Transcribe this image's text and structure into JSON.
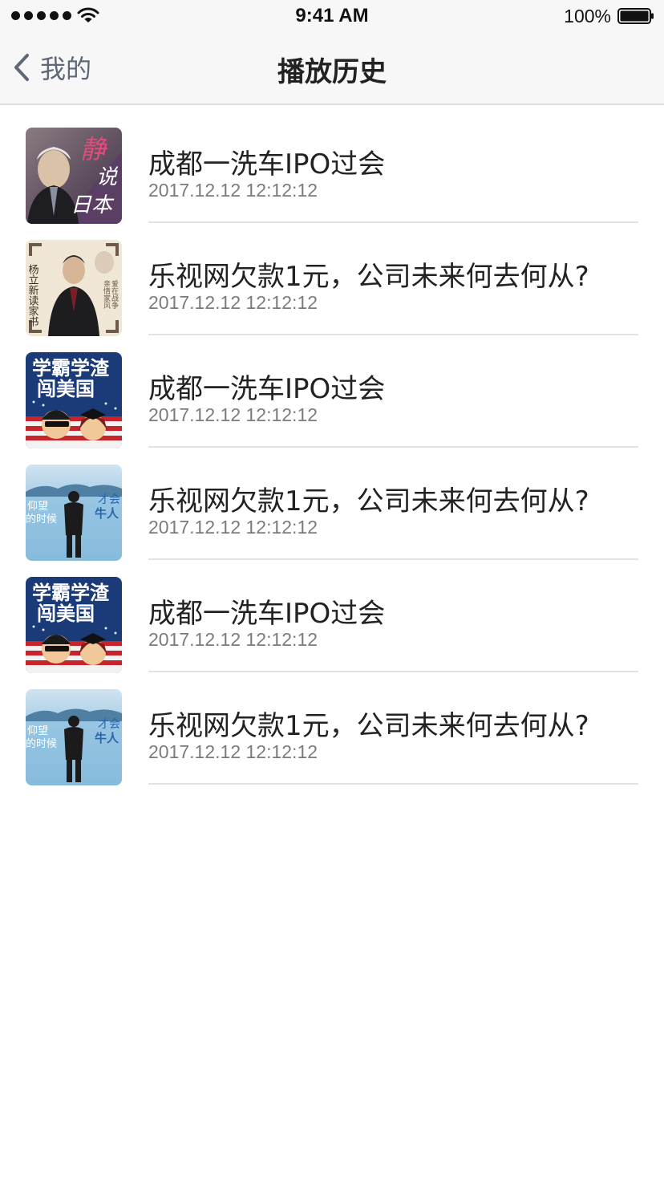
{
  "status_bar": {
    "time": "9:41 AM",
    "battery": "100%",
    "signal_icon": "signal-dots-icon",
    "wifi_icon": "wifi-icon",
    "battery_icon": "battery-icon"
  },
  "nav": {
    "back_label": "我的",
    "back_icon": "chevron-left-icon",
    "title": "播放历史"
  },
  "history": [
    {
      "title": "成都一洗车IPO过会",
      "time": "2017.12.12 12:12:12",
      "thumb_text": [
        "静",
        "说",
        "日本"
      ]
    },
    {
      "title": "乐视网欠款1元，公司未来何去何从?",
      "time": "2017.12.12 12:12:12",
      "thumb_text": [
        "杨立新读家书",
        "亲情家风",
        "爱在战争"
      ]
    },
    {
      "title": "成都一洗车IPO过会",
      "time": "2017.12.12 12:12:12",
      "thumb_text": [
        "学霸学渣",
        "闯美国"
      ]
    },
    {
      "title": "乐视网欠款1元，公司未来何去何从?",
      "time": "2017.12.12 12:12:12",
      "thumb_text": [
        "仰望",
        "的时候",
        "才会",
        "牛人"
      ]
    },
    {
      "title": "成都一洗车IPO过会",
      "time": "2017.12.12 12:12:12",
      "thumb_text": [
        "学霸学渣",
        "闯美国"
      ]
    },
    {
      "title": "乐视网欠款1元，公司未来何去何从?",
      "time": "2017.12.12 12:12:12",
      "thumb_text": [
        "仰望",
        "的时候",
        "才会",
        "牛人"
      ]
    }
  ],
  "colors": {
    "bar_background": "#f7f7f7",
    "back_tint": "#5f6779",
    "divider": "#e3e3e3",
    "timestamp": "#7b7b7b"
  }
}
